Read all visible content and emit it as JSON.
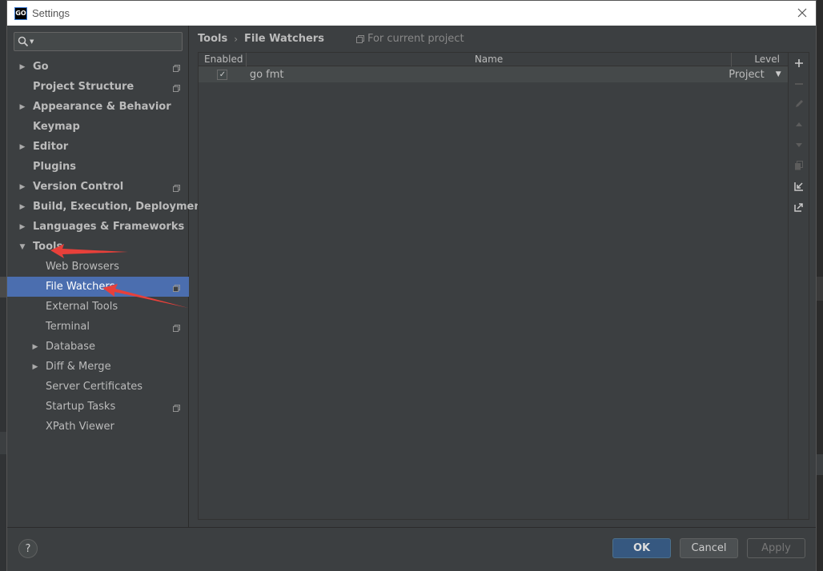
{
  "window": {
    "title": "Settings",
    "app_icon": "GO"
  },
  "search": {
    "placeholder": ""
  },
  "sidebar": {
    "items": [
      {
        "label": "Go",
        "expandable": true,
        "level": 0,
        "bold": true,
        "project": true
      },
      {
        "label": "Project Structure",
        "expandable": false,
        "level": 0,
        "bold": true,
        "project": true
      },
      {
        "label": "Appearance & Behavior",
        "expandable": true,
        "level": 0,
        "bold": true,
        "project": false
      },
      {
        "label": "Keymap",
        "expandable": false,
        "level": 0,
        "bold": true,
        "project": false
      },
      {
        "label": "Editor",
        "expandable": true,
        "level": 0,
        "bold": true,
        "project": false
      },
      {
        "label": "Plugins",
        "expandable": false,
        "level": 0,
        "bold": true,
        "project": false
      },
      {
        "label": "Version Control",
        "expandable": true,
        "level": 0,
        "bold": true,
        "project": true
      },
      {
        "label": "Build, Execution, Deployment",
        "expandable": true,
        "level": 0,
        "bold": true,
        "project": false
      },
      {
        "label": "Languages & Frameworks",
        "expandable": true,
        "level": 0,
        "bold": true,
        "project": false
      },
      {
        "label": "Tools",
        "expandable": true,
        "expanded": true,
        "level": 0,
        "bold": true,
        "project": false
      },
      {
        "label": "Web Browsers",
        "expandable": false,
        "level": 1,
        "bold": false,
        "project": false
      },
      {
        "label": "File Watchers",
        "expandable": false,
        "level": 1,
        "bold": false,
        "project": true,
        "selected": true
      },
      {
        "label": "External Tools",
        "expandable": false,
        "level": 1,
        "bold": false,
        "project": false
      },
      {
        "label": "Terminal",
        "expandable": false,
        "level": 1,
        "bold": false,
        "project": true
      },
      {
        "label": "Database",
        "expandable": true,
        "level": 1,
        "bold": false,
        "project": false
      },
      {
        "label": "Diff & Merge",
        "expandable": true,
        "level": 1,
        "bold": false,
        "project": false
      },
      {
        "label": "Server Certificates",
        "expandable": false,
        "level": 1,
        "bold": false,
        "project": false
      },
      {
        "label": "Startup Tasks",
        "expandable": false,
        "level": 1,
        "bold": false,
        "project": true
      },
      {
        "label": "XPath Viewer",
        "expandable": false,
        "level": 1,
        "bold": false,
        "project": false
      }
    ]
  },
  "breadcrumb": {
    "parent": "Tools",
    "separator": "›",
    "current": "File Watchers",
    "scope": "For current project"
  },
  "table": {
    "headers": {
      "enabled": "Enabled",
      "name": "Name",
      "level": "Level"
    },
    "rows": [
      {
        "enabled": true,
        "name": "go fmt",
        "level": "Project"
      }
    ]
  },
  "footer": {
    "help": "?",
    "ok": "OK",
    "cancel": "Cancel",
    "apply": "Apply"
  },
  "colors": {
    "selection": "#4b6eaf",
    "annotation_arrow": "#e8403a",
    "dialog_bg": "#3c3f41",
    "ok_button": "#365880"
  }
}
